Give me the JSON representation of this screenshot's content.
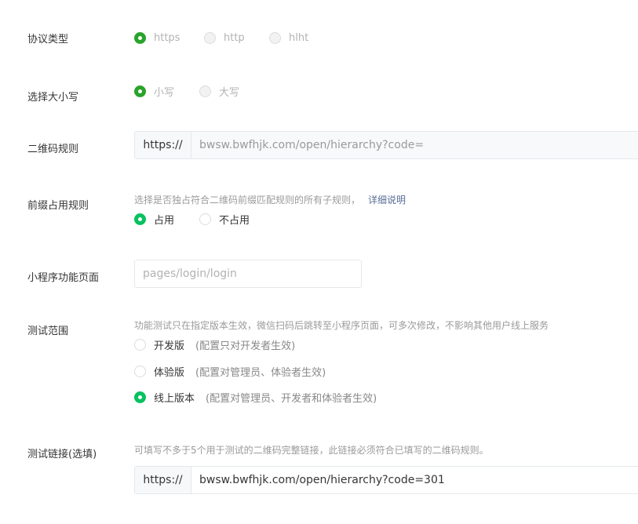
{
  "protocol": {
    "label": "协议类型",
    "options": [
      "https",
      "http",
      "hlht"
    ],
    "selected": "https"
  },
  "case": {
    "label": "选择大小写",
    "options": [
      "小写",
      "大写"
    ],
    "selected": "小写"
  },
  "qr_rule": {
    "label": "二维码规则",
    "prefix": "https://",
    "value": "bwsw.bwfhjk.com/open/hierarchy?code="
  },
  "prefix_rule": {
    "label": "前缀占用规则",
    "hint": "选择是否独占符合二维码前缀匹配规则的所有子规则，",
    "link": "详细说明",
    "options": [
      "占用",
      "不占用"
    ],
    "selected": "占用"
  },
  "mini_page": {
    "label": "小程序功能页面",
    "placeholder": "pages/login/login"
  },
  "test_scope": {
    "label": "测试范围",
    "hint": "功能测试只在指定版本生效，微信扫码后跳转至小程序页面，可多次修改，不影响其他用户线上服务",
    "options": [
      {
        "name": "开发版",
        "desc": "(配置只对开发者生效)"
      },
      {
        "name": "体验版",
        "desc": "(配置对管理员、体验者生效)"
      },
      {
        "name": "线上版本",
        "desc": "(配置对管理员、开发者和体验者生效)"
      }
    ],
    "selected": "线上版本"
  },
  "test_link": {
    "label": "测试链接(选填)",
    "hint": "可填写不多于5个用于测试的二维码完整链接，此链接必须符合已填写的二维码规则。",
    "prefix": "https://",
    "value": "bwsw.bwfhjk.com/open/hierarchy?code=301"
  },
  "colors": {
    "accent_dark": "#2aa32b",
    "accent_bright": "#07c160",
    "link": "#576b95",
    "muted": "#9a9a9a"
  }
}
